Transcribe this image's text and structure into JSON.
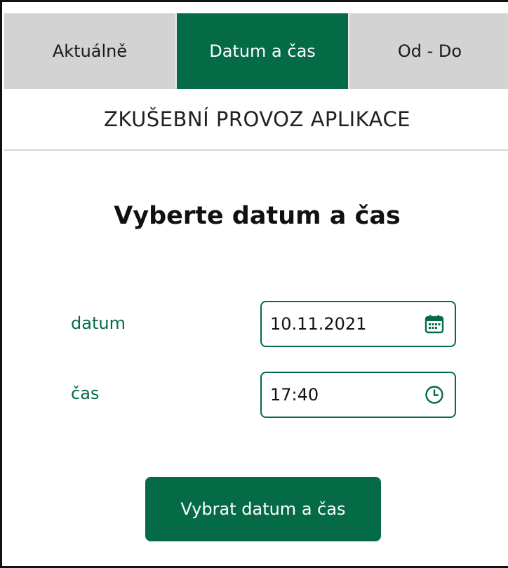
{
  "tabs": [
    {
      "label": "Aktuálně",
      "active": false
    },
    {
      "label": "Datum a čas",
      "active": true
    },
    {
      "label": "Od - Do",
      "active": false
    }
  ],
  "notice": "ZKUŠEBNÍ PROVOZ APLIKACE",
  "heading": "Vyberte datum a čas",
  "form": {
    "date": {
      "label": "datum",
      "value": "10.11.2021",
      "icon": "calendar-icon"
    },
    "time": {
      "label": "čas",
      "value": "17:40",
      "icon": "clock-icon"
    }
  },
  "submit_label": "Vybrat datum a čas",
  "colors": {
    "accent": "#056b46",
    "tab_bg": "#d3d3d3"
  }
}
